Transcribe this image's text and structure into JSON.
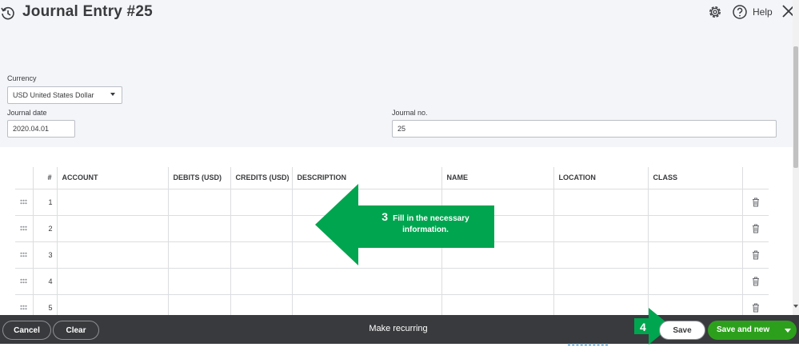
{
  "header": {
    "title": "Journal Entry #25",
    "help_label": "Help",
    "icons": [
      "history-icon",
      "gear-icon",
      "help-icon",
      "close-icon"
    ]
  },
  "form": {
    "currency_label": "Currency",
    "currency_value": "USD United States Dollar",
    "journal_date_label": "Journal date",
    "journal_date_value": "2020.04.01",
    "journal_no_label": "Journal no.",
    "journal_no_value": "25"
  },
  "table": {
    "columns": [
      "#",
      "ACCOUNT",
      "DEBITS (USD)",
      "CREDITS (USD)",
      "DESCRIPTION",
      "NAME",
      "LOCATION",
      "CLASS"
    ],
    "rows": [
      {
        "num": "1"
      },
      {
        "num": "2"
      },
      {
        "num": "3"
      },
      {
        "num": "4"
      },
      {
        "num": "5"
      }
    ]
  },
  "callouts": {
    "step3_number": "3",
    "step3_text_line1": "Fill in the necessary",
    "step3_text_line2": "information.",
    "step4_number": "4",
    "color": "#00a54f"
  },
  "footer": {
    "cancel_label": "Cancel",
    "clear_label": "Clear",
    "make_recurring_label": "Make recurring",
    "save_label": "Save",
    "save_and_new_label": "Save and new"
  },
  "colors": {
    "footer_bg": "#393a3d",
    "primary_green": "#2ca01c",
    "form_bg": "#f4f5f8"
  }
}
